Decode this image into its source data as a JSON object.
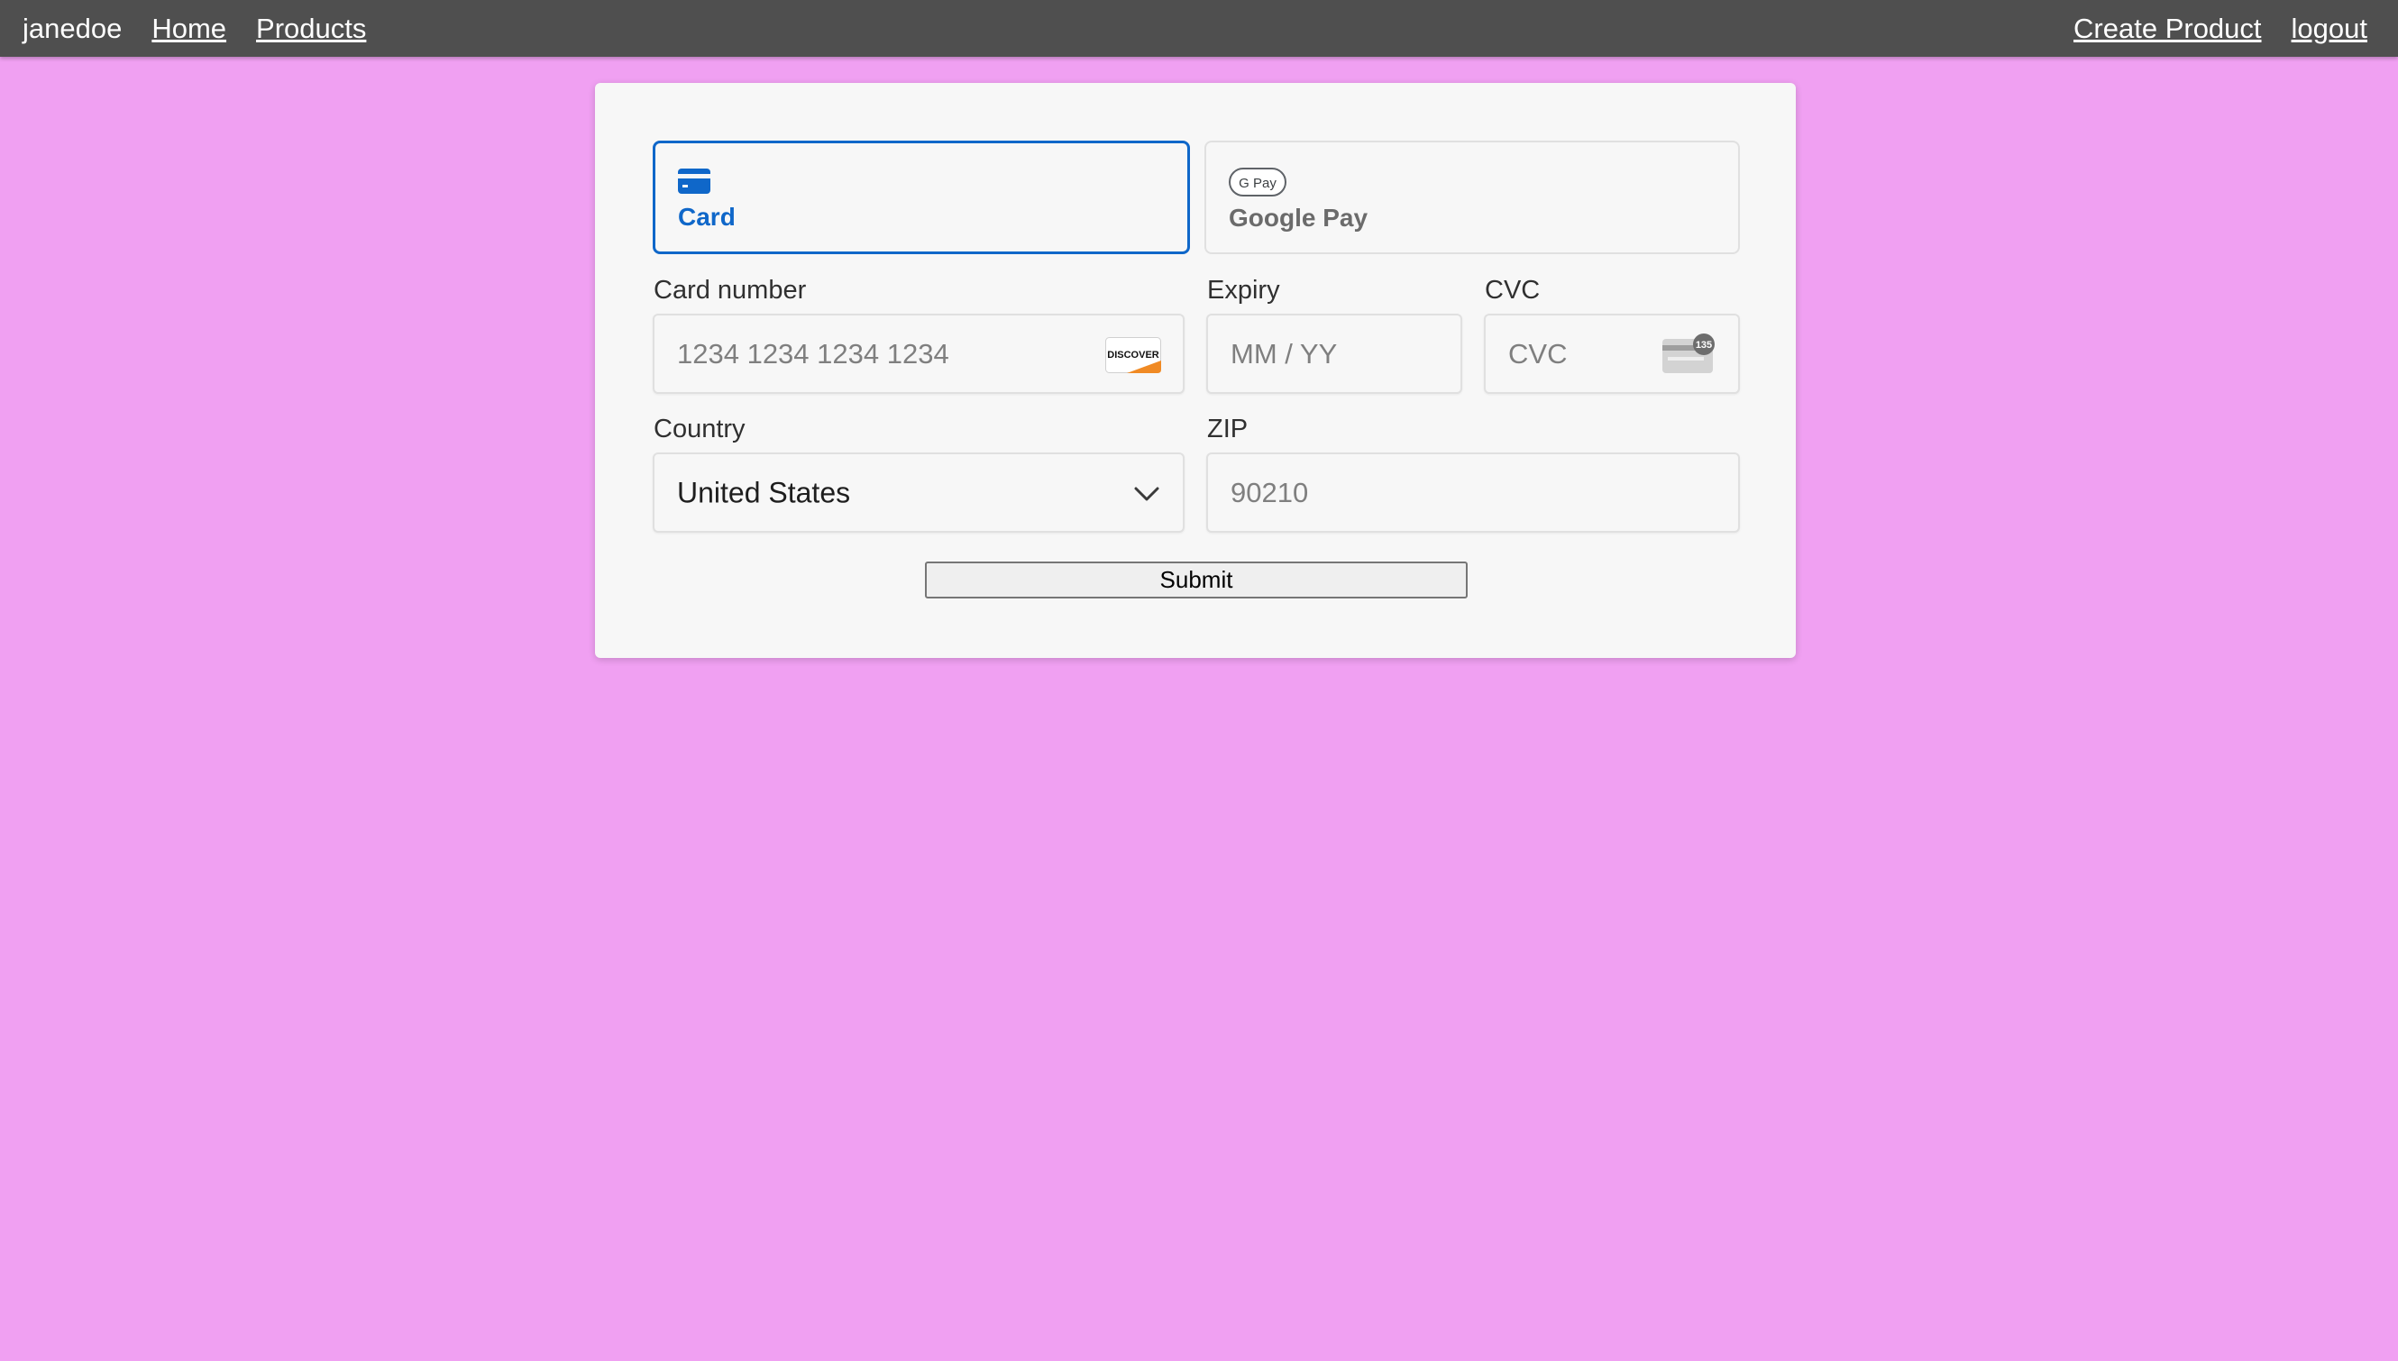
{
  "nav": {
    "username": "janedoe",
    "links_left": [
      "Home",
      "Products"
    ],
    "links_right": [
      "Create Product",
      "logout"
    ]
  },
  "payment": {
    "tabs": [
      {
        "label": "Card",
        "icon": "credit-card-icon",
        "active": true
      },
      {
        "label": "Google Pay",
        "icon": "google-pay-icon",
        "gpay_badge": "G Pay",
        "active": false
      }
    ],
    "card_number": {
      "label": "Card number",
      "placeholder": "1234 1234 1234 1234",
      "brand_icon": "discover-icon",
      "brand_text": "DISCOVER"
    },
    "expiry": {
      "label": "Expiry",
      "placeholder": "MM / YY"
    },
    "cvc": {
      "label": "CVC",
      "placeholder": "CVC",
      "icon": "cvc-card-icon",
      "badge": "135"
    },
    "country": {
      "label": "Country",
      "value": "United States"
    },
    "zip": {
      "label": "ZIP",
      "placeholder": "90210"
    },
    "submit_label": "Submit"
  },
  "colors": {
    "background": "#f0a0f2",
    "navbar": "#4f4f4f",
    "accent": "#0f67c9"
  }
}
